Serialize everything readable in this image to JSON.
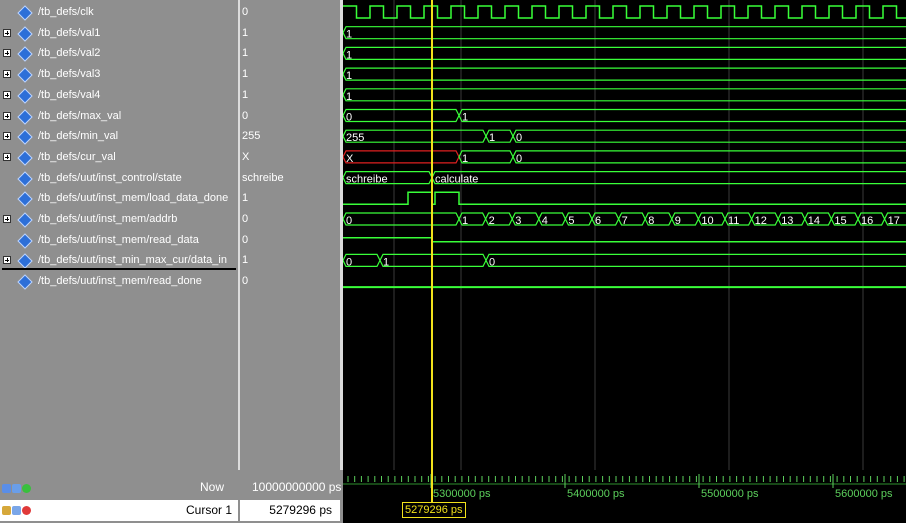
{
  "signals": [
    {
      "name": "/tb_defs/clk",
      "value": "0",
      "expandable": false
    },
    {
      "name": "/tb_defs/val1",
      "value": "1",
      "expandable": true
    },
    {
      "name": "/tb_defs/val2",
      "value": "1",
      "expandable": true
    },
    {
      "name": "/tb_defs/val3",
      "value": "1",
      "expandable": true
    },
    {
      "name": "/tb_defs/val4",
      "value": "1",
      "expandable": true
    },
    {
      "name": "/tb_defs/max_val",
      "value": "0",
      "expandable": true
    },
    {
      "name": "/tb_defs/min_val",
      "value": "255",
      "expandable": true
    },
    {
      "name": "/tb_defs/cur_val",
      "value": "X",
      "expandable": true
    },
    {
      "name": "/tb_defs/uut/inst_control/state",
      "value": "schreibe",
      "expandable": false
    },
    {
      "name": "/tb_defs/uut/inst_mem/load_data_done",
      "value": "1",
      "expandable": false
    },
    {
      "name": "/tb_defs/uut/inst_mem/addrb",
      "value": "0",
      "expandable": true
    },
    {
      "name": "/tb_defs/uut/inst_mem/read_data",
      "value": "0",
      "expandable": false
    },
    {
      "name": "/tb_defs/uut/inst_min_max_cur/data_in",
      "value": "1",
      "expandable": true
    },
    {
      "name": "/tb_defs/uut/inst_mem/read_done",
      "value": "0",
      "expandable": false
    }
  ],
  "waves": {
    "val1": "1",
    "val2": "1",
    "val3": "1",
    "val4": "1",
    "max_val": [
      "0",
      "1"
    ],
    "min_val": [
      "255",
      "1",
      "0"
    ],
    "cur_val": [
      "X",
      "1",
      "0"
    ],
    "state": [
      "schreibe",
      "calculate"
    ],
    "addrb": [
      "0",
      "1",
      "2",
      "3",
      "4",
      "5",
      "6",
      "7",
      "8",
      "9",
      "10",
      "11",
      "12",
      "13",
      "14",
      "15",
      "16",
      "17"
    ],
    "data_in": [
      "0",
      "1",
      "0"
    ]
  },
  "now": {
    "label": "Now",
    "value": "10000000000 ps"
  },
  "cursor": {
    "label": "Cursor 1",
    "value": "5279296 ps",
    "flag": "5279296 ps"
  },
  "timeline": {
    "labels": [
      "5300000 ps",
      "5400000 ps",
      "5500000 ps",
      "5600000 ps"
    ]
  },
  "colors": {
    "wave": "#39ff39",
    "cursor": "#f1e11b",
    "x_state": "#e02020",
    "pane": "#8f8f8f",
    "icon": "#2d6fd8"
  },
  "icons": {
    "signal": "diamond-icon",
    "expand": "plus-icon",
    "toolbar": [
      "zoom-icon",
      "add-icon",
      "lock-icon",
      "edit-icon",
      "delete-icon"
    ]
  }
}
